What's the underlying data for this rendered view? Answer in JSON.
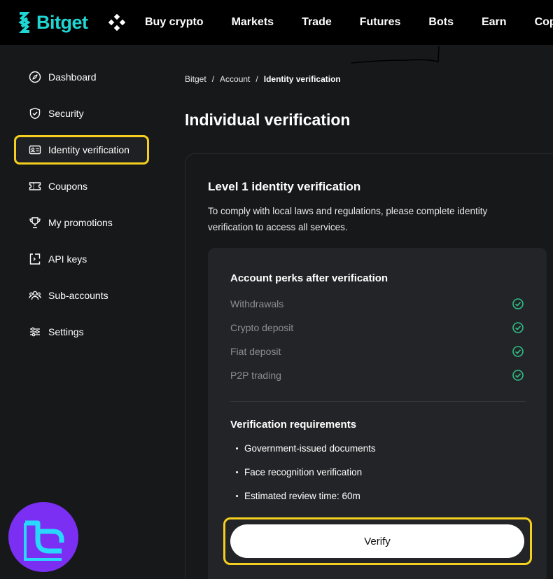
{
  "header": {
    "logo_text": "Bitget",
    "nav": [
      "Buy crypto",
      "Markets",
      "Trade",
      "Futures",
      "Bots",
      "Earn",
      "Copy"
    ]
  },
  "sidebar": {
    "items": [
      {
        "label": "Dashboard",
        "icon": "compass-icon"
      },
      {
        "label": "Security",
        "icon": "shield-check-icon"
      },
      {
        "label": "Identity verification",
        "icon": "id-card-icon",
        "active": true
      },
      {
        "label": "Coupons",
        "icon": "ticket-icon"
      },
      {
        "label": "My promotions",
        "icon": "trophy-icon"
      },
      {
        "label": "API keys",
        "icon": "api-key-icon"
      },
      {
        "label": "Sub-accounts",
        "icon": "users-icon"
      },
      {
        "label": "Settings",
        "icon": "sliders-icon"
      }
    ]
  },
  "breadcrumb": [
    "Bitget",
    "Account",
    "Identity verification"
  ],
  "main": {
    "title": "Individual verification",
    "card": {
      "title": "Level 1 identity verification",
      "description": "To comply with local laws and regulations, please complete identity verification to access all services.",
      "perks_title": "Account perks after verification",
      "perks": [
        "Withdrawals",
        "Crypto deposit",
        "Fiat deposit",
        "P2P trading"
      ],
      "requirements_title": "Verification requirements",
      "requirements": [
        "Government-issued documents",
        "Face recognition verification",
        "Estimated review time: 60m"
      ],
      "verify_label": "Verify"
    }
  },
  "colors": {
    "brand": "#1ed7d3",
    "highlight": "#f5cf1f",
    "check": "#2ebd85",
    "background": "#17181a"
  }
}
